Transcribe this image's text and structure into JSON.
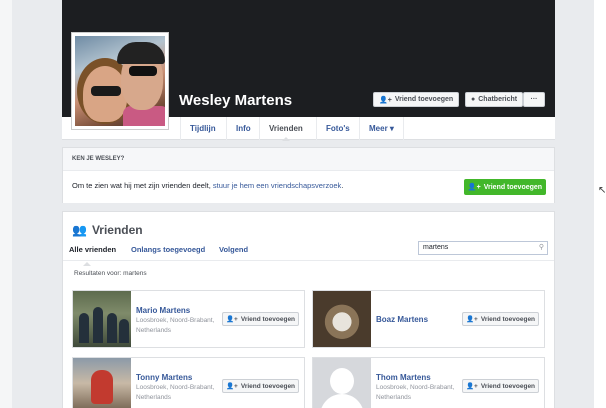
{
  "profile": {
    "name": "Wesley Martens",
    "add_friend_label": "Vriend toevoegen",
    "message_label": "Chatbericht",
    "more_dots": "···"
  },
  "tabs": [
    {
      "label": "Tijdlijn"
    },
    {
      "label": "Info"
    },
    {
      "label": "Vrienden"
    },
    {
      "label": "Foto's"
    },
    {
      "label": "Meer ▾"
    }
  ],
  "know": {
    "heading": "KEN JE WESLEY?",
    "text": "Om te zien wat hij met zijn vrienden deelt, ",
    "link": "stuur je hem een vriendschapsverzoek",
    "text_end": ".",
    "button": "Vriend toevoegen"
  },
  "friends": {
    "title": "Vrienden",
    "subtabs": [
      "Alle vrienden",
      "Onlangs toegevoegd",
      "Volgend"
    ],
    "search_value": "martens",
    "results_label": "Resultaten voor: martens",
    "add_label": "Vriend toevoegen",
    "list": [
      {
        "name": "Mario Martens",
        "location": "Loosbroek, Noord-Brabant, Netherlands"
      },
      {
        "name": "Boaz Martens",
        "location": ""
      },
      {
        "name": "Tonny Martens",
        "location": "Loosbroek, Noord-Brabant, Netherlands"
      },
      {
        "name": "Thom Martens",
        "location": "Loosbroek, Noord-Brabant, Netherlands"
      }
    ]
  },
  "colors": {
    "link_blue": "#365899",
    "green_button": "#42b72a",
    "cover_dark": "#1c1e21",
    "page_bg": "#e9ebee"
  }
}
